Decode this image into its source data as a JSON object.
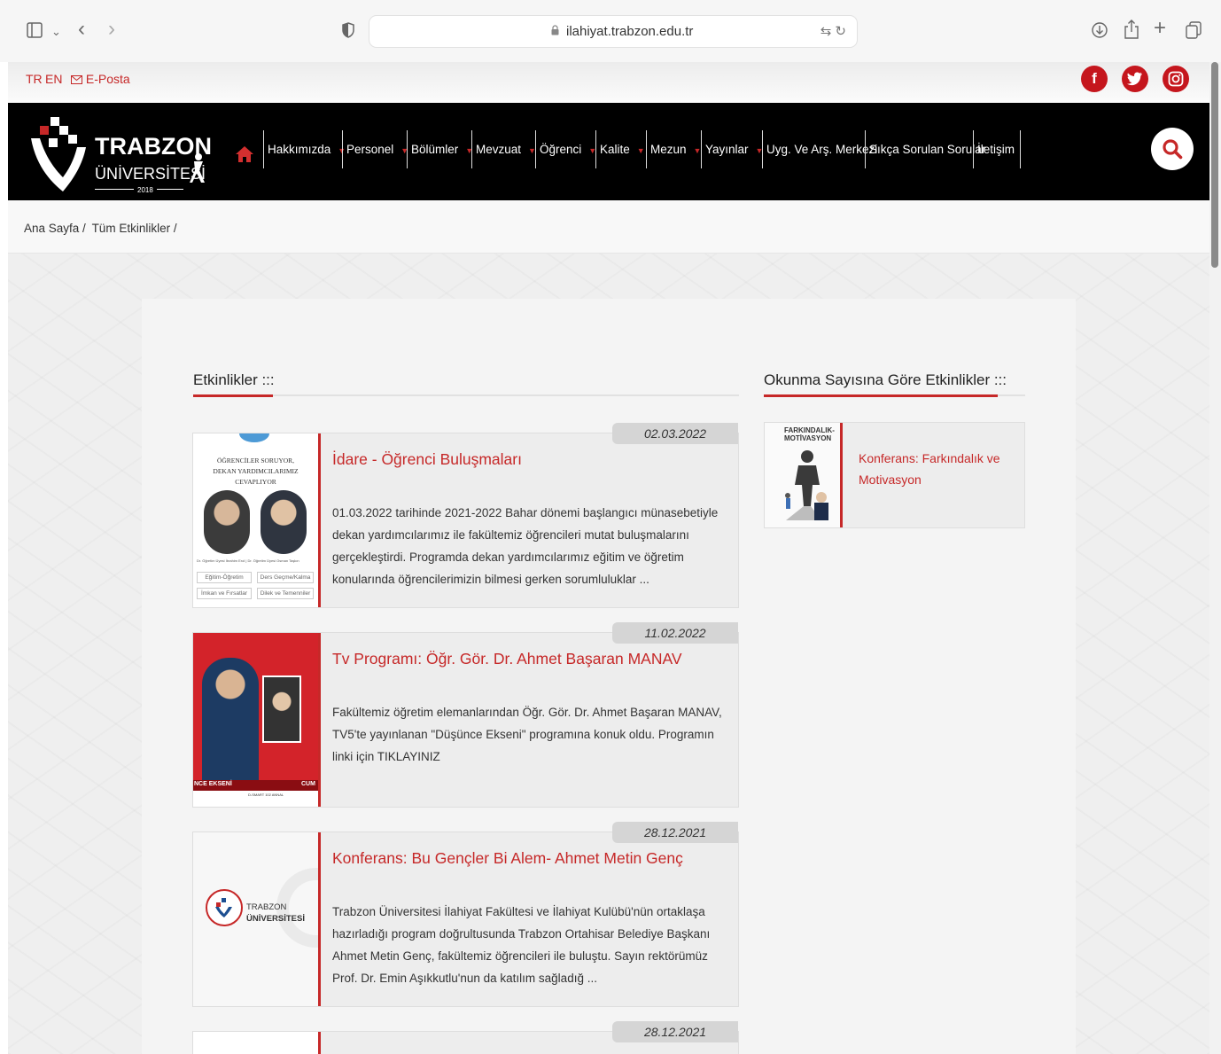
{
  "browser": {
    "url": "ilahiyat.trabzon.edu.tr"
  },
  "topbar": {
    "lang_tr": "TR",
    "lang_en": "EN",
    "email": "E-Posta",
    "social": [
      "f",
      "t",
      "ig"
    ]
  },
  "logo": {
    "title": "TRABZON",
    "subtitle": "ÜNİVERSİTESİ",
    "year": "2018"
  },
  "nav": {
    "items": [
      {
        "label": "Hakkımızda"
      },
      {
        "label": "Personel"
      },
      {
        "label": "Bölümler"
      },
      {
        "label": "Mevzuat"
      },
      {
        "label": "Öğrenci"
      },
      {
        "label": "Kalite"
      },
      {
        "label": "Mezun"
      },
      {
        "label": "Yayınlar"
      },
      {
        "label": "Uyg. Ve Arş. Merkezi"
      },
      {
        "label": "Sıkça Sorulan Sorular"
      },
      {
        "label": "İletişim"
      }
    ]
  },
  "breadcrumb": {
    "home": "Ana Sayfa /",
    "current": "Tüm Etkinlikler /"
  },
  "events": {
    "title": "Etkinlikler :::",
    "items": [
      {
        "date": "02.03.2022",
        "title": "İdare - Öğrenci Buluşmaları",
        "desc": "01.03.2022 tarihinde 2021-2022 Bahar dönemi başlangıcı münasebetiyle dekan yardımcılarımız ile fakültemiz öğrencileri mutat buluşmalarını gerçekleştirdi. Programda dekan yardımcılarımız eğitim ve öğretim konularında öğrencilerimizin bilmesi gerken sorumluluklar ...",
        "thumb": {
          "line1": "ÖĞRENCİLER SORUYOR,",
          "line2": "DEKAN YARDIMCILARIMIZ",
          "line3": "CEVAPLIYOR",
          "captions": "Dr. Öğretim Üyesi İbrahim Erol | Dr. Öğretim Üyesi Osman Taşkın",
          "tags": [
            "Eğitim-Öğretim",
            "Ders Geçme/Kalma",
            "İmkan ve Fırsatlar",
            "Dilek ve Temenniler"
          ]
        }
      },
      {
        "date": "11.02.2022",
        "title": "Tv Programı: Öğr. Gör. Dr. Ahmet Başaran MANAV",
        "desc": "Fakültemiz öğretim elemanlarından Öğr. Gör. Dr. Ahmet Başaran MANAV, TV5'te yayınlanan \"Düşünce Ekseni\" programına konuk oldu. Programın linki için TIKLAYINIZ",
        "thumb": {
          "band_left": "NCE EKSENİ",
          "band_right": "CUM",
          "footer": "D-SMART 102 ANNAL"
        }
      },
      {
        "date": "28.12.2021",
        "title": "Konferans: Bu Gençler Bi Alem- Ahmet Metin Genç",
        "desc": "Trabzon Üniversitesi İlahiyat Fakültesi ve İlahiyat Kulübü'nün ortaklaşa hazırladığı program doğrultusunda Trabzon Ortahisar Belediye Başkanı Ahmet Metin Genç, fakültemiz öğrencileri ile buluştu. Sayın rektörümüz Prof. Dr. Emin Aşıkkutlu'nun da katılım sağladığ ...",
        "thumb": {
          "name1": "TRABZON",
          "name2": "ÜNİVERSİTESİ"
        }
      },
      {
        "date": "28.12.2021"
      }
    ]
  },
  "popular": {
    "title": "Okunma Sayısına Göre Etkinlikler :::",
    "items": [
      {
        "title": "Konferans: Farkındalık ve Motivasyon",
        "thumb_line1": "FARKINDALIK-",
        "thumb_line2": "MOTİVASYON"
      }
    ]
  },
  "colors": {
    "accent": "#c62828",
    "nav_bg": "#000000"
  }
}
